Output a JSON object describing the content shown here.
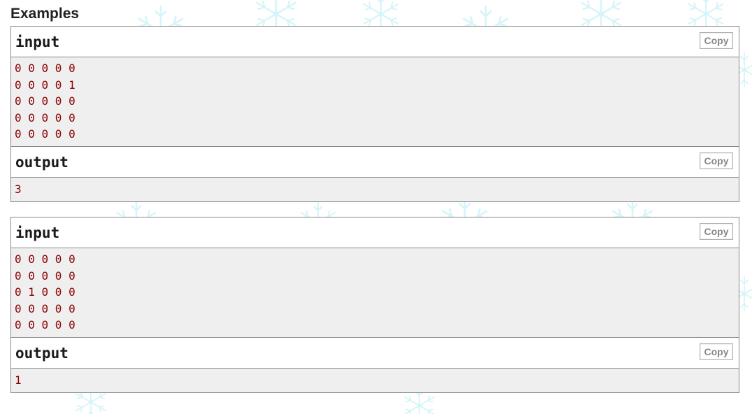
{
  "section_title": "Examples",
  "copy_label": "Copy",
  "examples": [
    {
      "input_label": "input",
      "input_lines": [
        "0 0 0 0 0",
        "0 0 0 0 1",
        "0 0 0 0 0",
        "0 0 0 0 0",
        "0 0 0 0 0"
      ],
      "output_label": "output",
      "output_lines": [
        "3"
      ]
    },
    {
      "input_label": "input",
      "input_lines": [
        "0 0 0 0 0",
        "0 0 0 0 0",
        "0 1 0 0 0",
        "0 0 0 0 0",
        "0 0 0 0 0"
      ],
      "output_label": "output",
      "output_lines": [
        "1"
      ]
    }
  ],
  "colors": {
    "text_red": "#8b0000",
    "panel_bg": "#efefef",
    "border": "#888888",
    "snowflake": "#bfeef5"
  },
  "background_icon": "snowflake-icon"
}
